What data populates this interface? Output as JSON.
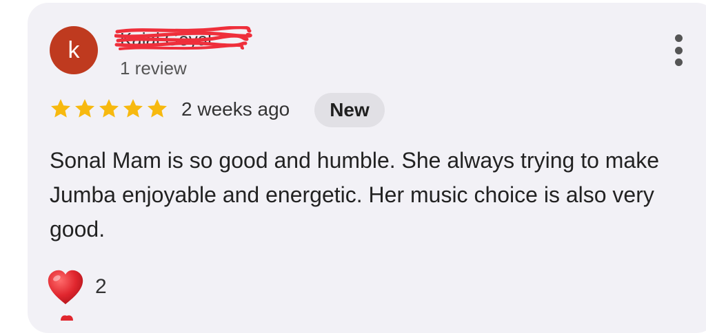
{
  "reviewer": {
    "avatar_initial": "k",
    "name": "Kajal Goyal",
    "review_count": "1 review"
  },
  "rating": {
    "stars": 5,
    "max": 5
  },
  "time_ago": "2 weeks ago",
  "badge": "New",
  "review_text": "Sonal Mam is so good and humble. She always trying to make Jumba enjoyable and energetic. Her music choice is also very good.",
  "reactions": {
    "icon": "heart-icon",
    "count": "2"
  },
  "colors": {
    "card_bg": "#f2f1f6",
    "avatar_bg": "#bf3a1f",
    "star": "#f7b90f",
    "badge_bg": "#e1e0e5",
    "heart": "#e0262e",
    "redaction": "#ef2f3b"
  },
  "icons": {
    "more": "vertical-dots-icon",
    "star": "star-icon"
  }
}
